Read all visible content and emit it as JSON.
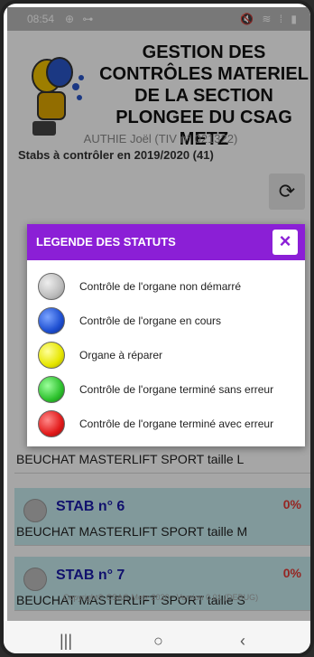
{
  "status_bar": {
    "time": "08:54",
    "left_icons": "⊕ ⊶",
    "right_icons": "🔇 ≋ ⁞ ▮"
  },
  "header": {
    "title_lines": [
      "GESTION DES",
      "CONTRÔLES MATERIEL",
      "DE LA SECTION",
      "PLONGEE DU CSAG",
      "METZ"
    ],
    "user": "AUTHIE Joël (TIV n° 021322)",
    "stabs_line": "Stabs à contrôler en 2019/2020 (41)",
    "refresh_icon": "⟳"
  },
  "list": {
    "rows": [
      {
        "stab": "STAB n° 6",
        "pct": "0%",
        "model": "BEUCHAT MASTERLIFT SPORT taille M"
      },
      {
        "stab": "STAB n° 7",
        "pct": "0%",
        "model": "BEUCHAT MASTERLIFT SPORT taille S"
      }
    ],
    "partial_model": "BEUCHAT MASTERLIFT SPORT taille L"
  },
  "footer": "Copyright© CSAG Metz 2020 - Version 0.01 (DEBUG)",
  "modal": {
    "title": "LEGENDE DES STATUTS",
    "close": "×",
    "items": [
      {
        "label": "Contrôle de l'organe non démarré",
        "color": "#bdbdbd"
      },
      {
        "label": "Contrôle de l'organe en cours",
        "color": "#1e4fd1"
      },
      {
        "label": "Organe à réparer",
        "color": "#e6e600"
      },
      {
        "label": "Contrôle de l'organe terminé sans erreur",
        "color": "#2ec22e"
      },
      {
        "label": "Contrôle de l'organe terminé avec erreur",
        "color": "#e21a1a"
      }
    ]
  },
  "navbar": {
    "recent": "|||",
    "home": "○",
    "back": "‹"
  }
}
